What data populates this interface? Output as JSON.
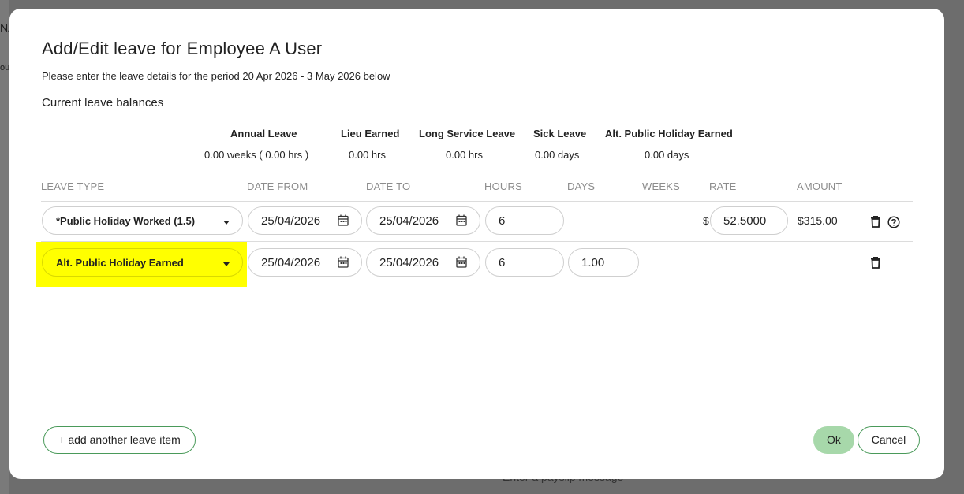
{
  "background": {
    "left_fragment_1": "NA",
    "left_fragment_2": "ou",
    "bottom_message": "Enter a payslip message"
  },
  "modal": {
    "title": "Add/Edit leave for Employee A User",
    "subtitle": "Please enter the leave details for the period 20 Apr 2026 - 3 May 2026 below",
    "balances_title": "Current leave balances",
    "balances": [
      {
        "label": "Annual Leave",
        "value": "0.00 weeks ( 0.00 hrs )"
      },
      {
        "label": "Lieu Earned",
        "value": "0.00 hrs"
      },
      {
        "label": "Long Service Leave",
        "value": "0.00 hrs"
      },
      {
        "label": "Sick Leave",
        "value": "0.00 days"
      },
      {
        "label": "Alt. Public Holiday Earned",
        "value": "0.00 days"
      }
    ],
    "columns": {
      "leave_type": "LEAVE TYPE",
      "date_from": "DATE FROM",
      "date_to": "DATE TO",
      "hours": "HOURS",
      "days": "DAYS",
      "weeks": "WEEKS",
      "rate": "RATE",
      "amount": "AMOUNT"
    },
    "rows": [
      {
        "leave_type": "*Public Holiday Worked (1.5)",
        "date_from": "25/04/2026",
        "date_to": "25/04/2026",
        "hours": "6",
        "rate_currency": "$",
        "rate": "52.5000",
        "amount": "$315.00"
      },
      {
        "leave_type": "Alt. Public Holiday Earned",
        "date_from": "25/04/2026",
        "date_to": "25/04/2026",
        "hours": "6",
        "days": "1.00"
      }
    ],
    "add_item_label": "+ add another leave item",
    "ok_label": "Ok",
    "cancel_label": "Cancel"
  },
  "colors": {
    "highlight": "#ffff00",
    "ok_bg": "#a7d8aa",
    "outline_green": "#4a9a5a",
    "column_header": "#8c8c8c"
  }
}
